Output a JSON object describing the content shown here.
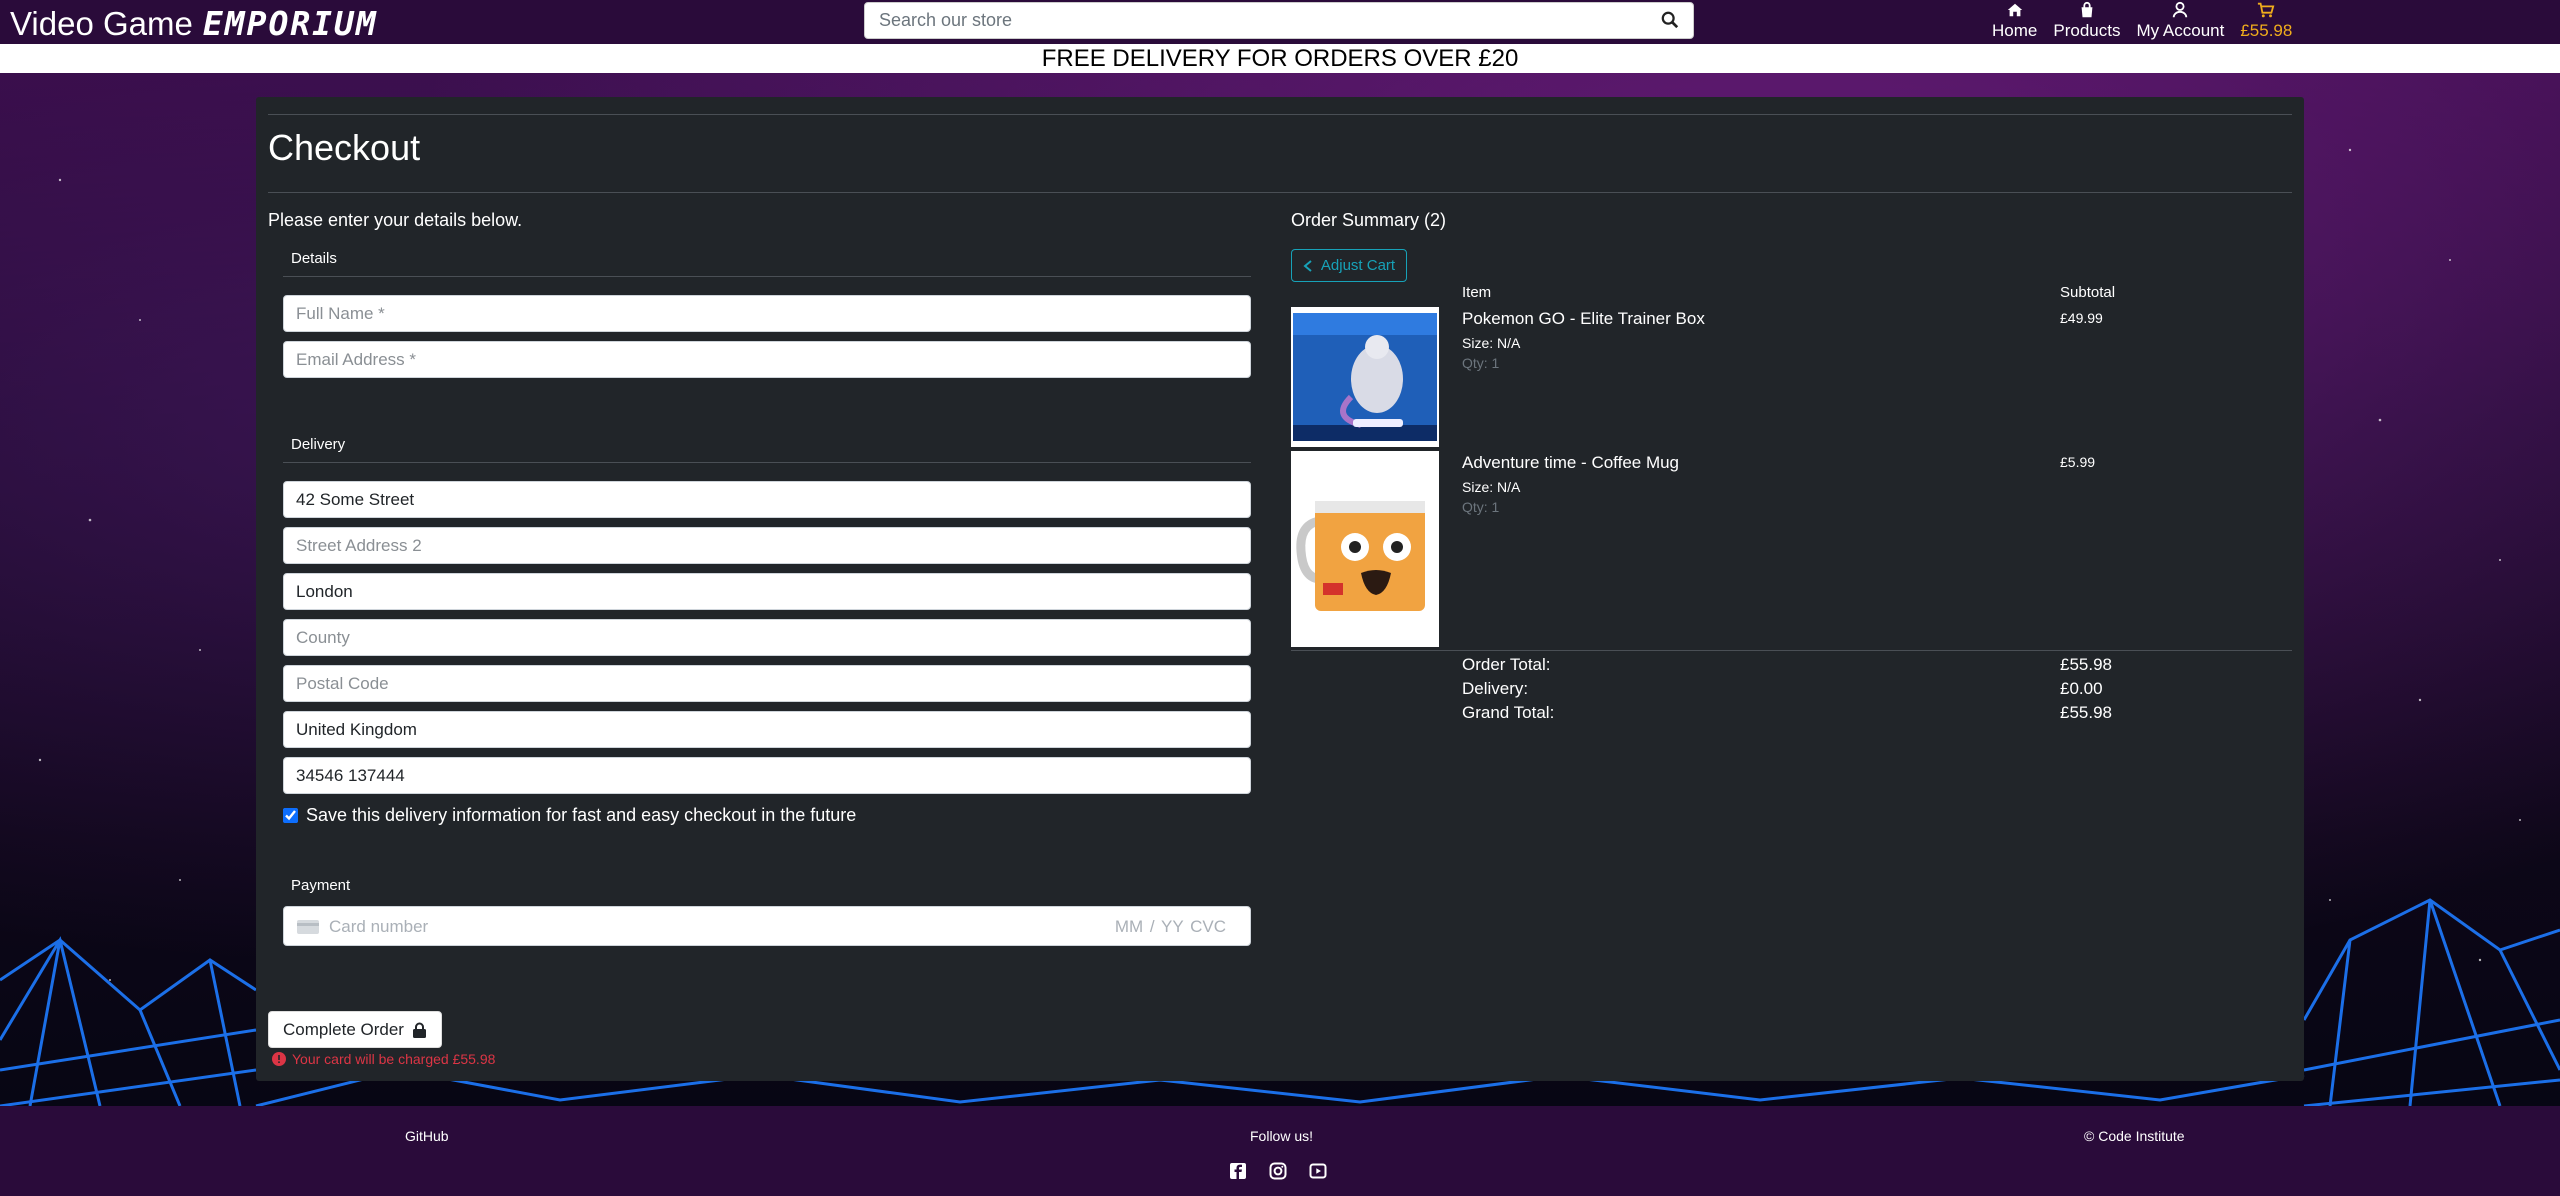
{
  "brand": {
    "name": "Video Game",
    "emphasis": "EMPORIUM"
  },
  "search": {
    "placeholder": "Search our store",
    "icon": "search-icon"
  },
  "nav": [
    {
      "label": "Home",
      "icon": "home-icon"
    },
    {
      "label": "Products",
      "icon": "bag-icon"
    },
    {
      "label": "My Account",
      "icon": "user-icon"
    },
    {
      "label": "£55.98",
      "icon": "cart-icon"
    }
  ],
  "banner": "FREE DELIVERY FOR ORDERS OVER £20",
  "checkout": {
    "title": "Checkout",
    "intro": "Please enter your details below.",
    "details_label": "Details",
    "fields": {
      "full_name_placeholder": "Full Name *",
      "email_placeholder": "Email Address *"
    },
    "delivery_label": "Delivery",
    "delivery": {
      "street1": "42 Some Street",
      "street2_placeholder": "Street Address 2",
      "town": "London",
      "county_placeholder": "County",
      "postcode_placeholder": "Postal Code",
      "country": "United Kingdom",
      "phone": "34546 137444"
    },
    "save_info_label": "Save this delivery information for fast and easy checkout in the future",
    "save_info_checked": true,
    "payment_label": "Payment",
    "card": {
      "number_placeholder": "Card number",
      "expiry_placeholder": "MM / YY  CVC"
    },
    "complete_button": "Complete Order",
    "charge_notice": "Your card will be charged £55.98"
  },
  "summary": {
    "title": "Order Summary (2)",
    "adjust_button": "Adjust Cart",
    "col_item": "Item",
    "col_subtotal": "Subtotal",
    "items": [
      {
        "name": "Pokemon GO - Elite Trainer Box",
        "size": "Size: N/A",
        "qty": "Qty: 1",
        "price": "£49.99"
      },
      {
        "name": "Adventure time - Coffee Mug",
        "size": "Size: N/A",
        "qty": "Qty: 1",
        "price": "£5.99"
      }
    ],
    "totals": [
      {
        "label": "Order Total:",
        "value": "£55.98"
      },
      {
        "label": "Delivery:",
        "value": "£0.00"
      },
      {
        "label": "Grand Total:",
        "value": "£55.98"
      }
    ]
  },
  "footer": {
    "github": "GitHub",
    "follow": "Follow us!",
    "copyright": "© Code Institute",
    "social_icons": [
      "facebook-icon",
      "instagram-icon",
      "youtube-icon"
    ]
  },
  "colors": {
    "header_bg": "#2a0b3a",
    "panel_bg": "#212529",
    "cart_total": "#f0ad1c",
    "accent_info": "#17a2b8",
    "danger": "#dc3545"
  }
}
